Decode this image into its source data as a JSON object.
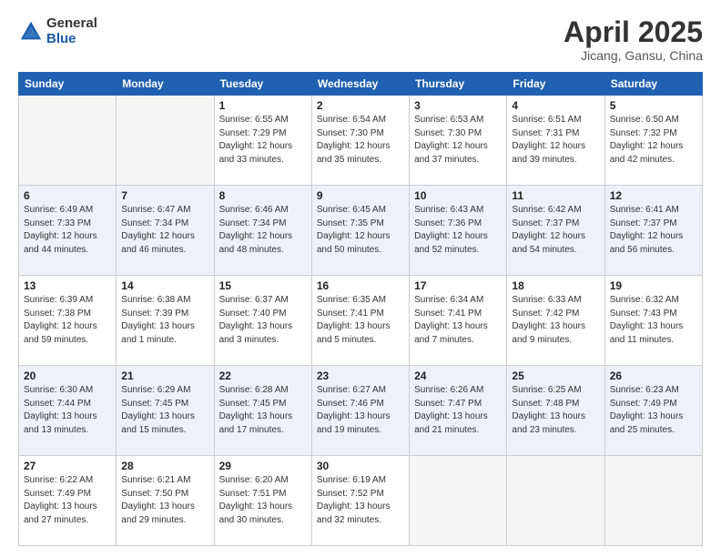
{
  "logo": {
    "general": "General",
    "blue": "Blue"
  },
  "header": {
    "title": "April 2025",
    "subtitle": "Jicang, Gansu, China"
  },
  "weekdays": [
    "Sunday",
    "Monday",
    "Tuesday",
    "Wednesday",
    "Thursday",
    "Friday",
    "Saturday"
  ],
  "days": [
    {
      "date": "",
      "sunrise": "",
      "sunset": "",
      "daylight": ""
    },
    {
      "date": "",
      "sunrise": "",
      "sunset": "",
      "daylight": ""
    },
    {
      "date": "1",
      "sunrise": "Sunrise: 6:55 AM",
      "sunset": "Sunset: 7:29 PM",
      "daylight": "Daylight: 12 hours and 33 minutes."
    },
    {
      "date": "2",
      "sunrise": "Sunrise: 6:54 AM",
      "sunset": "Sunset: 7:30 PM",
      "daylight": "Daylight: 12 hours and 35 minutes."
    },
    {
      "date": "3",
      "sunrise": "Sunrise: 6:53 AM",
      "sunset": "Sunset: 7:30 PM",
      "daylight": "Daylight: 12 hours and 37 minutes."
    },
    {
      "date": "4",
      "sunrise": "Sunrise: 6:51 AM",
      "sunset": "Sunset: 7:31 PM",
      "daylight": "Daylight: 12 hours and 39 minutes."
    },
    {
      "date": "5",
      "sunrise": "Sunrise: 6:50 AM",
      "sunset": "Sunset: 7:32 PM",
      "daylight": "Daylight: 12 hours and 42 minutes."
    },
    {
      "date": "6",
      "sunrise": "Sunrise: 6:49 AM",
      "sunset": "Sunset: 7:33 PM",
      "daylight": "Daylight: 12 hours and 44 minutes."
    },
    {
      "date": "7",
      "sunrise": "Sunrise: 6:47 AM",
      "sunset": "Sunset: 7:34 PM",
      "daylight": "Daylight: 12 hours and 46 minutes."
    },
    {
      "date": "8",
      "sunrise": "Sunrise: 6:46 AM",
      "sunset": "Sunset: 7:34 PM",
      "daylight": "Daylight: 12 hours and 48 minutes."
    },
    {
      "date": "9",
      "sunrise": "Sunrise: 6:45 AM",
      "sunset": "Sunset: 7:35 PM",
      "daylight": "Daylight: 12 hours and 50 minutes."
    },
    {
      "date": "10",
      "sunrise": "Sunrise: 6:43 AM",
      "sunset": "Sunset: 7:36 PM",
      "daylight": "Daylight: 12 hours and 52 minutes."
    },
    {
      "date": "11",
      "sunrise": "Sunrise: 6:42 AM",
      "sunset": "Sunset: 7:37 PM",
      "daylight": "Daylight: 12 hours and 54 minutes."
    },
    {
      "date": "12",
      "sunrise": "Sunrise: 6:41 AM",
      "sunset": "Sunset: 7:37 PM",
      "daylight": "Daylight: 12 hours and 56 minutes."
    },
    {
      "date": "13",
      "sunrise": "Sunrise: 6:39 AM",
      "sunset": "Sunset: 7:38 PM",
      "daylight": "Daylight: 12 hours and 59 minutes."
    },
    {
      "date": "14",
      "sunrise": "Sunrise: 6:38 AM",
      "sunset": "Sunset: 7:39 PM",
      "daylight": "Daylight: 13 hours and 1 minute."
    },
    {
      "date": "15",
      "sunrise": "Sunrise: 6:37 AM",
      "sunset": "Sunset: 7:40 PM",
      "daylight": "Daylight: 13 hours and 3 minutes."
    },
    {
      "date": "16",
      "sunrise": "Sunrise: 6:35 AM",
      "sunset": "Sunset: 7:41 PM",
      "daylight": "Daylight: 13 hours and 5 minutes."
    },
    {
      "date": "17",
      "sunrise": "Sunrise: 6:34 AM",
      "sunset": "Sunset: 7:41 PM",
      "daylight": "Daylight: 13 hours and 7 minutes."
    },
    {
      "date": "18",
      "sunrise": "Sunrise: 6:33 AM",
      "sunset": "Sunset: 7:42 PM",
      "daylight": "Daylight: 13 hours and 9 minutes."
    },
    {
      "date": "19",
      "sunrise": "Sunrise: 6:32 AM",
      "sunset": "Sunset: 7:43 PM",
      "daylight": "Daylight: 13 hours and 11 minutes."
    },
    {
      "date": "20",
      "sunrise": "Sunrise: 6:30 AM",
      "sunset": "Sunset: 7:44 PM",
      "daylight": "Daylight: 13 hours and 13 minutes."
    },
    {
      "date": "21",
      "sunrise": "Sunrise: 6:29 AM",
      "sunset": "Sunset: 7:45 PM",
      "daylight": "Daylight: 13 hours and 15 minutes."
    },
    {
      "date": "22",
      "sunrise": "Sunrise: 6:28 AM",
      "sunset": "Sunset: 7:45 PM",
      "daylight": "Daylight: 13 hours and 17 minutes."
    },
    {
      "date": "23",
      "sunrise": "Sunrise: 6:27 AM",
      "sunset": "Sunset: 7:46 PM",
      "daylight": "Daylight: 13 hours and 19 minutes."
    },
    {
      "date": "24",
      "sunrise": "Sunrise: 6:26 AM",
      "sunset": "Sunset: 7:47 PM",
      "daylight": "Daylight: 13 hours and 21 minutes."
    },
    {
      "date": "25",
      "sunrise": "Sunrise: 6:25 AM",
      "sunset": "Sunset: 7:48 PM",
      "daylight": "Daylight: 13 hours and 23 minutes."
    },
    {
      "date": "26",
      "sunrise": "Sunrise: 6:23 AM",
      "sunset": "Sunset: 7:49 PM",
      "daylight": "Daylight: 13 hours and 25 minutes."
    },
    {
      "date": "27",
      "sunrise": "Sunrise: 6:22 AM",
      "sunset": "Sunset: 7:49 PM",
      "daylight": "Daylight: 13 hours and 27 minutes."
    },
    {
      "date": "28",
      "sunrise": "Sunrise: 6:21 AM",
      "sunset": "Sunset: 7:50 PM",
      "daylight": "Daylight: 13 hours and 29 minutes."
    },
    {
      "date": "29",
      "sunrise": "Sunrise: 6:20 AM",
      "sunset": "Sunset: 7:51 PM",
      "daylight": "Daylight: 13 hours and 30 minutes."
    },
    {
      "date": "30",
      "sunrise": "Sunrise: 6:19 AM",
      "sunset": "Sunset: 7:52 PM",
      "daylight": "Daylight: 13 hours and 32 minutes."
    },
    {
      "date": "",
      "sunrise": "",
      "sunset": "",
      "daylight": ""
    },
    {
      "date": "",
      "sunrise": "",
      "sunset": "",
      "daylight": ""
    },
    {
      "date": "",
      "sunrise": "",
      "sunset": "",
      "daylight": ""
    }
  ]
}
